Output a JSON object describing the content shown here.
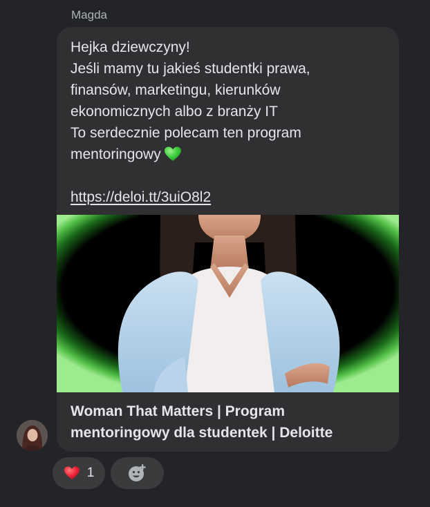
{
  "message": {
    "sender": "Magda",
    "lines": [
      "Hejka dziewczyny!",
      "Jeśli mamy tu jakieś studentki prawa,",
      "finansów, marketingu, kierunków",
      "ekonomicznych albo z branży IT",
      "To serdecznie polecam ten program",
      "mentoringowy"
    ],
    "emoji": "green-heart-icon",
    "link": "https://deloi.tt/3uiO8l2"
  },
  "link_preview": {
    "title_line1": "Woman That Matters | Program",
    "title_line2": "mentoringowy dla studentek | Deloitte"
  },
  "reactions": {
    "heart_count": "1",
    "heart_icon": "red-heart-icon",
    "add_icon": "add-reaction-icon"
  },
  "colors": {
    "background": "#232427",
    "bubble": "#303033",
    "text": "#e4e6eb",
    "accent_green": "#3fcf3f"
  }
}
